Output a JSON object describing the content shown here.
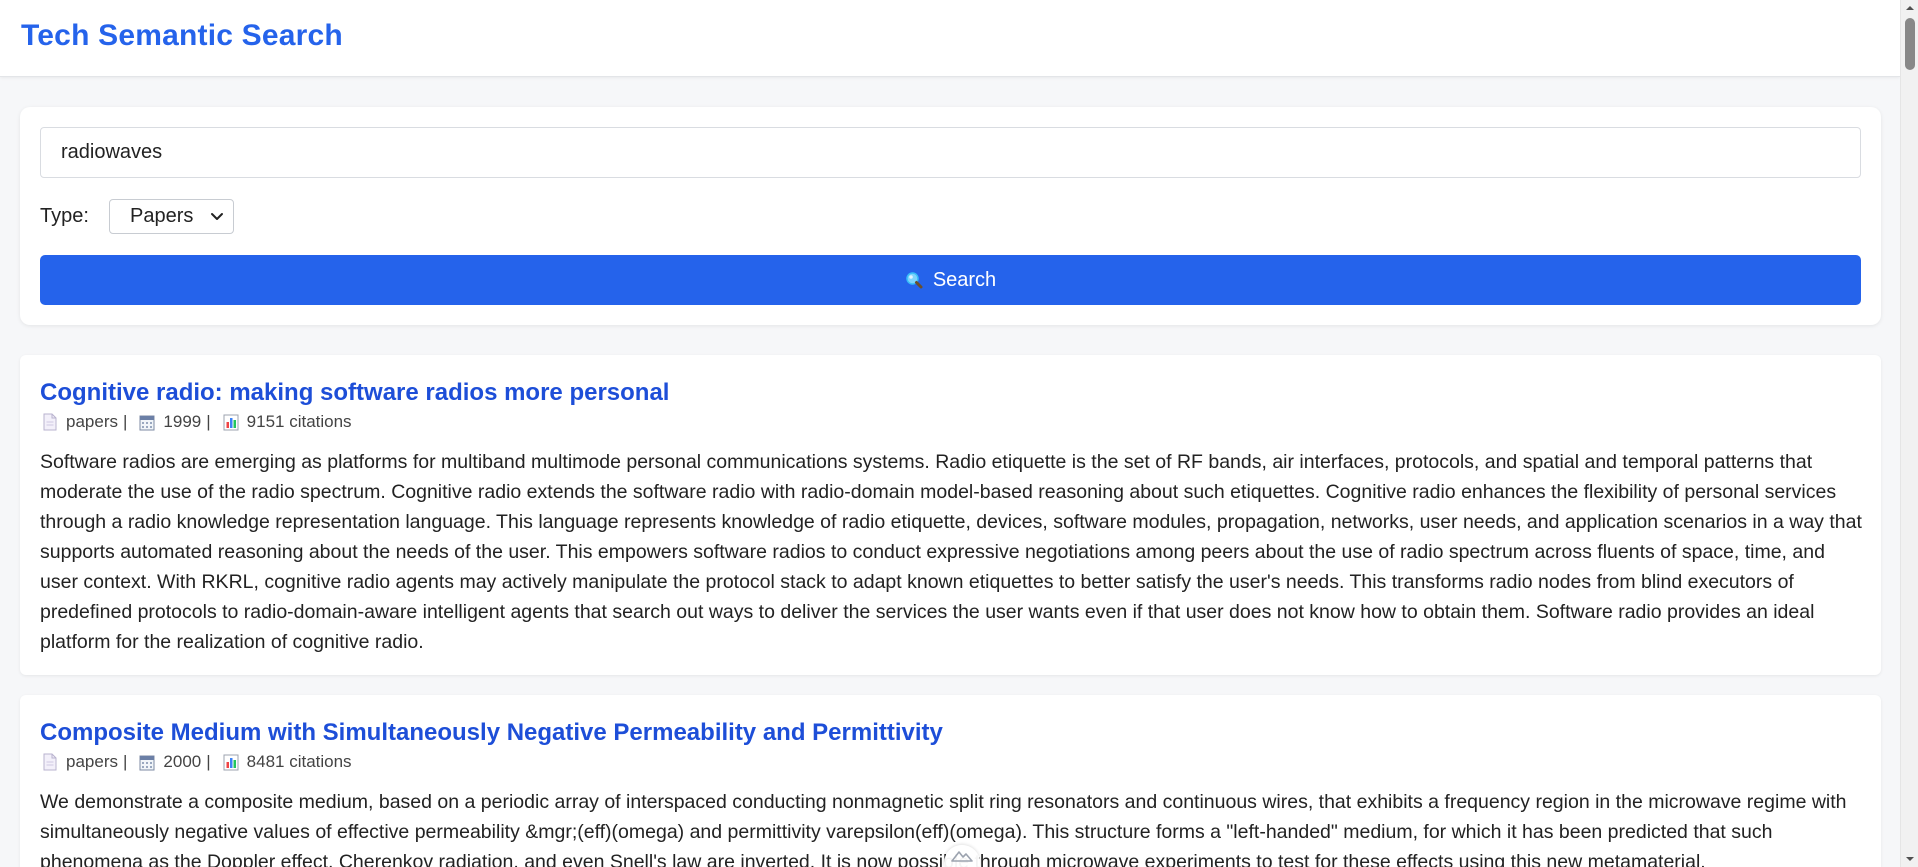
{
  "app": {
    "title": "Tech Semantic Search"
  },
  "search": {
    "query": "radiowaves",
    "type_label": "Type:",
    "type_selected": "Papers",
    "button_label": "Search",
    "button_icon": "magnifier-icon"
  },
  "results": [
    {
      "title": "Cognitive radio: making software radios more personal",
      "type": "papers",
      "year": "1999",
      "citations": "9151 citations",
      "abstract": "Software radios are emerging as platforms for multiband multimode personal communications systems. Radio etiquette is the set of RF bands, air interfaces, protocols, and spatial and temporal patterns that moderate the use of the radio spectrum. Cognitive radio extends the software radio with radio-domain model-based reasoning about such etiquettes. Cognitive radio enhances the flexibility of personal services through a radio knowledge representation language. This language represents knowledge of radio etiquette, devices, software modules, propagation, networks, user needs, and application scenarios in a way that supports automated reasoning about the needs of the user. This empowers software radios to conduct expressive negotiations among peers about the use of radio spectrum across fluents of space, time, and user context. With RKRL, cognitive radio agents may actively manipulate the protocol stack to adapt known etiquettes to better satisfy the user's needs. This transforms radio nodes from blind executors of predefined protocols to radio-domain-aware intelligent agents that search out ways to deliver the services the user wants even if that user does not know how to obtain them. Software radio provides an ideal platform for the realization of cognitive radio."
    },
    {
      "title": "Composite Medium with Simultaneously Negative Permeability and Permittivity",
      "type": "papers",
      "year": "2000",
      "citations": "8481 citations",
      "abstract": "We demonstrate a composite medium, based on a periodic array of interspaced conducting nonmagnetic split ring resonators and continuous wires, that exhibits a frequency region in the microwave regime with simultaneously negative values of effective permeability &mgr;(eff)(omega) and permittivity varepsilon(eff)(omega). This structure forms a \"left-handed\" medium, for which it has been predicted that such phenomena as the Doppler effect, Cherenkov radiation, and even Snell's law are inverted. It is now possible through microwave experiments to test for these effects using this new metamaterial."
    }
  ],
  "colors": {
    "accent": "#2563eb",
    "title_link": "#1d4ed8",
    "background": "#f6f7f9"
  },
  "icons": {
    "type": "document-icon",
    "year": "calendar-icon",
    "citations": "bar-chart-icon"
  }
}
